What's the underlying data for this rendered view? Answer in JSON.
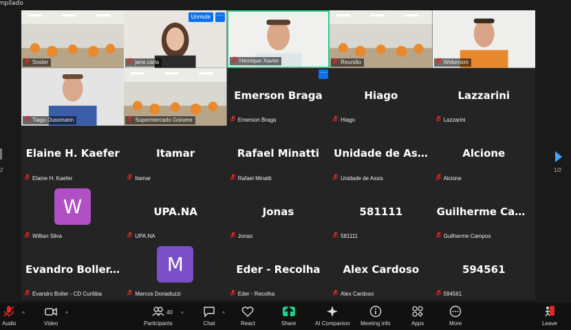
{
  "window": {
    "title": "empilado"
  },
  "video_tiles": [
    {
      "name": "Soster",
      "scene": "room"
    },
    {
      "name": "jane.carla",
      "scene": "woman",
      "unmute_label": "Unmute"
    },
    {
      "name": "Henrique Xavier",
      "scene": "man-headset",
      "active": true
    },
    {
      "name": "Reunião",
      "scene": "room"
    },
    {
      "name": "Weberson",
      "scene": "man-orange"
    },
    {
      "name": "Tiago Dussmann",
      "scene": "man-blue"
    },
    {
      "name": "Supermercado Goioere",
      "scene": "room-office"
    }
  ],
  "name_tiles": [
    {
      "display": "Emerson Braga",
      "label": "Emerson Braga"
    },
    {
      "display": "Hiago",
      "label": "Hiago"
    },
    {
      "display": "Lazzarini",
      "label": "Lazzarini"
    },
    {
      "display": "Elaine H. Kaefer",
      "label": "Elaine H. Kaefer"
    },
    {
      "display": "Itamar",
      "label": "Itamar"
    },
    {
      "display": "Rafael Minatti",
      "label": "Rafael Minatti"
    },
    {
      "display": "Unidade de Assis",
      "label": "Unidade de Assis"
    },
    {
      "display": "Alcione",
      "label": "Alcione"
    },
    {
      "avatar_letter": "W",
      "avatar_color": "#b14fc5",
      "label": "Willian Silva"
    },
    {
      "display": "UPA.NA",
      "label": "UPA.NA"
    },
    {
      "display": "Jonas",
      "label": "Jonas"
    },
    {
      "display": "581111",
      "label": "581111"
    },
    {
      "display": "Guilherme  Cam...",
      "label": "Guilherme Campos"
    },
    {
      "display": "Evandro  Boller...",
      "label": "Evandro Boller - CD Curitiba"
    },
    {
      "avatar_letter": "M",
      "avatar_color": "#7b4fc7",
      "label": "Marcos Donaduzzi"
    },
    {
      "display": "Eder - Recolha",
      "label": "Eder - Recolha"
    },
    {
      "display": "Alex Cardoso",
      "label": "Alex Cardoso"
    },
    {
      "display": "594561",
      "label": "594561"
    }
  ],
  "pager": {
    "right": "1/2",
    "left": "2"
  },
  "toolbar": {
    "audio": "Audio",
    "video": "Video",
    "participants": "Participants",
    "participants_count": "40",
    "chat": "Chat",
    "react": "React",
    "share": "Share",
    "ai_companion": "AI Companion",
    "meeting_info": "Meeting info",
    "apps": "Apps",
    "more": "More",
    "leave": "Leave"
  },
  "colors": {
    "active_speaker": "#23d18b",
    "accent": "#0e71eb",
    "mute": "#e02828",
    "share": "#23d18b",
    "leave": "#e02828"
  }
}
